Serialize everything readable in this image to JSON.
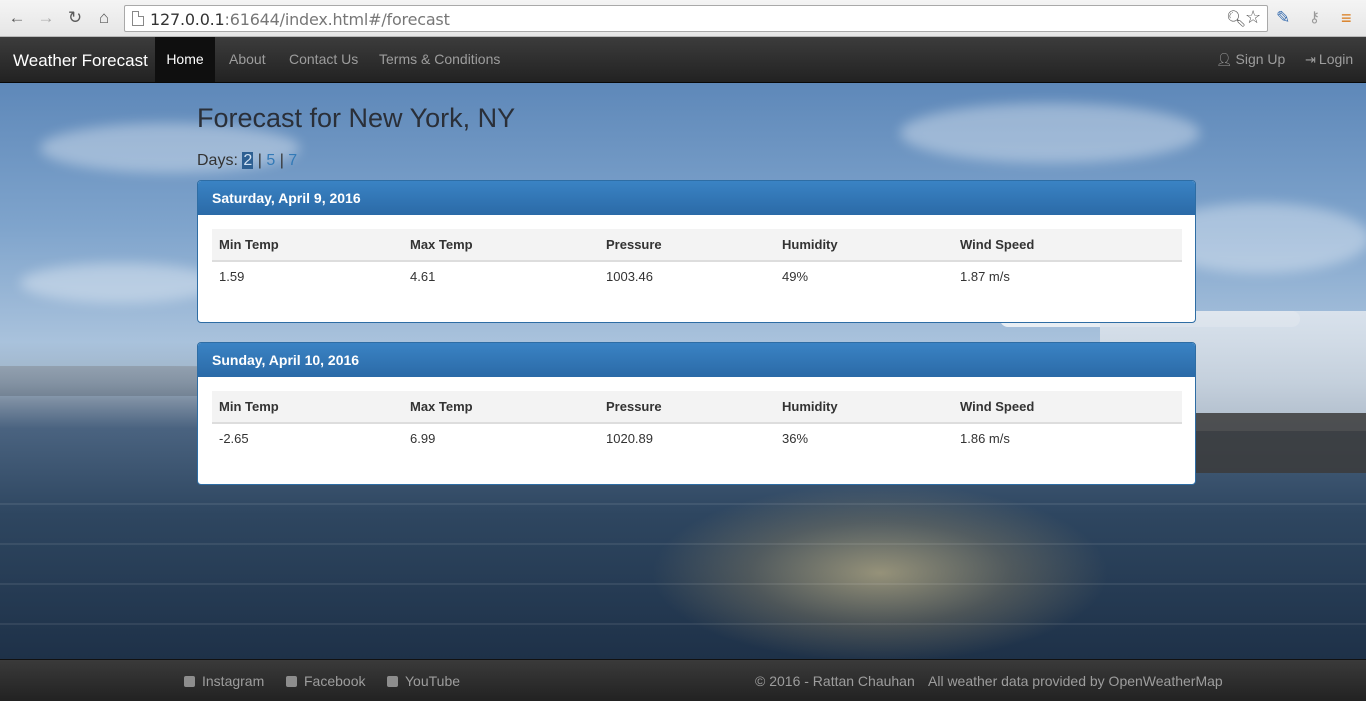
{
  "browser": {
    "url_host": "127.0.0.1",
    "url_port": ":61644",
    "url_path": "/index.html#/forecast"
  },
  "navbar": {
    "brand": "Weather Forecast",
    "items": [
      {
        "label": "Home",
        "active": true
      },
      {
        "label": "About"
      },
      {
        "label": "Contact Us"
      },
      {
        "label": "Terms & Conditions"
      }
    ],
    "signup": "Sign Up",
    "login": "Login"
  },
  "main": {
    "heading": "Forecast for New York, NY",
    "days_label": "Days:",
    "days_options": [
      "2",
      "5",
      "7"
    ],
    "selected_days": "2"
  },
  "table_headers": [
    "Min Temp",
    "Max Temp",
    "Pressure",
    "Humidity",
    "Wind Speed"
  ],
  "forecasts": [
    {
      "date": "Saturday, April 9, 2016",
      "min_temp": "1.59",
      "max_temp": "4.61",
      "pressure": "1003.46",
      "humidity": "49%",
      "wind_speed": "1.87 m/s"
    },
    {
      "date": "Sunday, April 10, 2016",
      "min_temp": "-2.65",
      "max_temp": "6.99",
      "pressure": "1020.89",
      "humidity": "36%",
      "wind_speed": "1.86 m/s"
    }
  ],
  "footer": {
    "instagram": "Instagram",
    "facebook": "Facebook",
    "youtube": "YouTube",
    "copyright": "© 2016 - Rattan Chauhan",
    "attribution": "All weather data provided by OpenWeatherMap"
  },
  "colors": {
    "panel_header": "#337ab7",
    "navbar": "#222222",
    "link": "#337ab7"
  }
}
